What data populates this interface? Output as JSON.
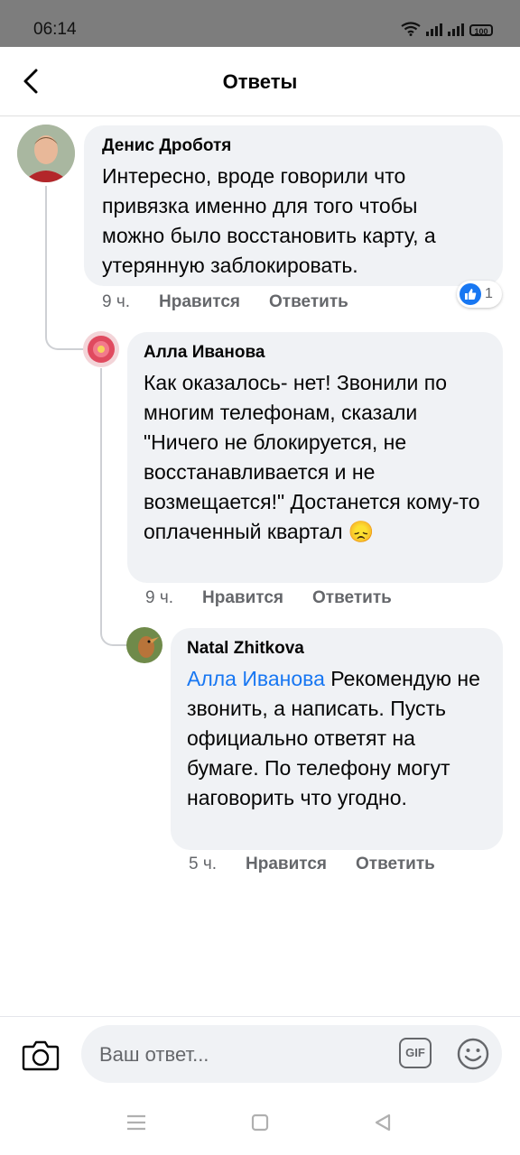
{
  "status": {
    "time": "06:14",
    "battery": "100"
  },
  "header": {
    "title": "Ответы",
    "back_icon": "chevron-left-icon"
  },
  "comments": [
    {
      "author": "Денис Дроботя",
      "text": "Интересно, вроде говорили что привязка именно для того чтобы можно было восстановить карту, а утерянную заблокировать.",
      "time": "9 ч.",
      "like_label": "Нравится",
      "reply_label": "Ответить",
      "reaction": {
        "icon": "like-icon",
        "count": "1"
      }
    },
    {
      "author": "Алла Иванова",
      "text": "Как оказалось- нет! Звонили по многим телефонам, сказали \"Ничего не блокируется, не восстанавливается и не возмещается!\" Достанется кому-то оплаченный квартал",
      "emoji": "😞",
      "time": "9 ч.",
      "like_label": "Нравится",
      "reply_label": "Ответить"
    },
    {
      "author": "Natal Zhitkova",
      "mention": "Алла Иванова",
      "text": "Рекомендую не звонить, а написать. Пусть официально ответят на бумаге. По телефону могут наговорить что угодно.",
      "time": "5 ч.",
      "like_label": "Нравится",
      "reply_label": "Ответить"
    }
  ],
  "composer": {
    "placeholder": "Ваш ответ...",
    "gif_label": "GIF",
    "camera_icon": "camera-icon",
    "emoji_icon": "smile-icon"
  },
  "colors": {
    "link": "#1877f2",
    "bubble": "#f0f2f5",
    "meta": "#65676b",
    "status_bar": "#7d7d7d"
  }
}
